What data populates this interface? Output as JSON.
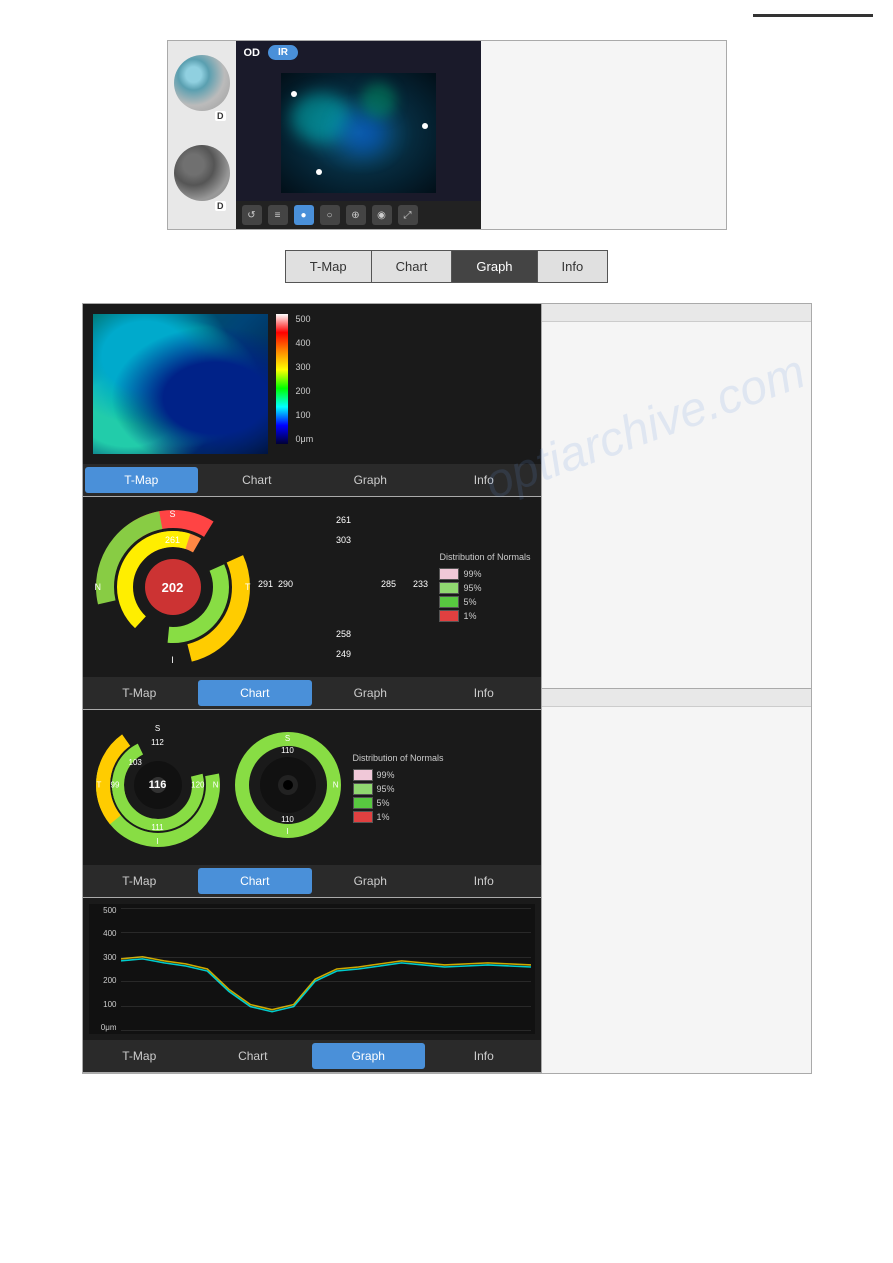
{
  "topbar": {
    "line_label": ""
  },
  "preview": {
    "od_label": "OD",
    "ir_label": "IR",
    "thumb1_d": "D",
    "thumb2_d": "D"
  },
  "nav": {
    "tabs": [
      {
        "id": "tmap",
        "label": "T-Map",
        "active": false
      },
      {
        "id": "chart",
        "label": "Chart",
        "active": false
      },
      {
        "id": "graph",
        "label": "Graph",
        "active": false
      },
      {
        "id": "info",
        "label": "Info",
        "active": false
      }
    ]
  },
  "tmap_panel": {
    "scale_labels": [
      "500",
      "400",
      "300",
      "200",
      "100",
      "0μm"
    ],
    "tabs": [
      "T-Map",
      "Chart",
      "Graph",
      "Info"
    ],
    "active_tab": "T-Map"
  },
  "chart_panel": {
    "direction_labels": {
      "s": "S",
      "i": "I",
      "n": "N",
      "t": "T"
    },
    "values": {
      "s_outer": "261",
      "s_inner": "303",
      "center": "202",
      "n_outer": "291",
      "n_inner": "290",
      "t_inner": "285",
      "t_outer": "233",
      "i_inner": "258",
      "i_outer": "249"
    },
    "distribution_title": "Distribution of Normals",
    "distribution_items": [
      {
        "color": "#f0c8d8",
        "label": "99%"
      },
      {
        "color": "#90d870",
        "label": "95%"
      },
      {
        "color": "#58c840",
        "label": "5%"
      },
      {
        "color": "#e04040",
        "label": "1%"
      }
    ],
    "tabs": [
      "T-Map",
      "Chart",
      "Graph",
      "Info"
    ],
    "active_tab": "Chart"
  },
  "chart2_panel": {
    "left_donut": {
      "s_label": "S",
      "t_label": "T",
      "n_label": "N",
      "i_label": "I",
      "s_val": "112",
      "n_val": "99",
      "center_val": "116",
      "n2_val": "103",
      "t_val": "120",
      "i_val": "111"
    },
    "right_donut": {
      "s_label": "S",
      "n_label": "N",
      "i_label": "I",
      "s_val": "110",
      "center_val": "",
      "i_val": "110"
    },
    "distribution_title": "Distribution of Normals",
    "distribution_items": [
      {
        "color": "#f0c8d8",
        "label": "99%"
      },
      {
        "color": "#90d870",
        "label": "95%"
      },
      {
        "color": "#58c840",
        "label": "5%"
      },
      {
        "color": "#e04040",
        "label": "1%"
      }
    ],
    "tabs": [
      "T-Map",
      "Chart",
      "Graph",
      "Info"
    ],
    "active_tab": "Chart"
  },
  "graph_panel": {
    "y_labels": [
      "500",
      "400",
      "300",
      "200",
      "100",
      "0μm"
    ],
    "tabs": [
      "T-Map",
      "Chart",
      "Graph",
      "Info"
    ],
    "active_tab": "Graph"
  },
  "watermark": "optiarchive.com"
}
